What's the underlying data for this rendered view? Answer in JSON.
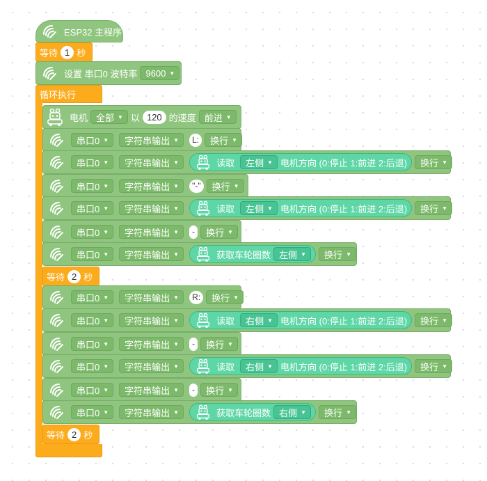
{
  "program": {
    "start_label": "ESP32 主程序",
    "wait1": {
      "label": "等待",
      "value": "1",
      "unit": "秒"
    },
    "baud": {
      "label": "设置 串口0 波特率",
      "value": "9600"
    },
    "loop_label": "循环执行"
  },
  "common": {
    "port": "串口0",
    "string_output": "字符串输出",
    "newline": "换行",
    "read": "读取",
    "direction_text": "电机方向 (0:停止 1:前进 2:后退)",
    "wheel_turns": "获取车轮圈数",
    "left": "左侧",
    "right": "右侧"
  },
  "motor": {
    "label": "电机",
    "which": "全部",
    "with": "以",
    "speed": "120",
    "speed_text": "的速度",
    "dir": "前进"
  },
  "strings": {
    "l_label": "L:",
    "quote_dash": "\"-\"",
    "dash": "-",
    "r_label": "R:"
  },
  "wait2": {
    "label": "等待",
    "value": "2",
    "unit": "秒"
  },
  "wait3": {
    "label": "等待",
    "value": "2",
    "unit": "秒"
  }
}
